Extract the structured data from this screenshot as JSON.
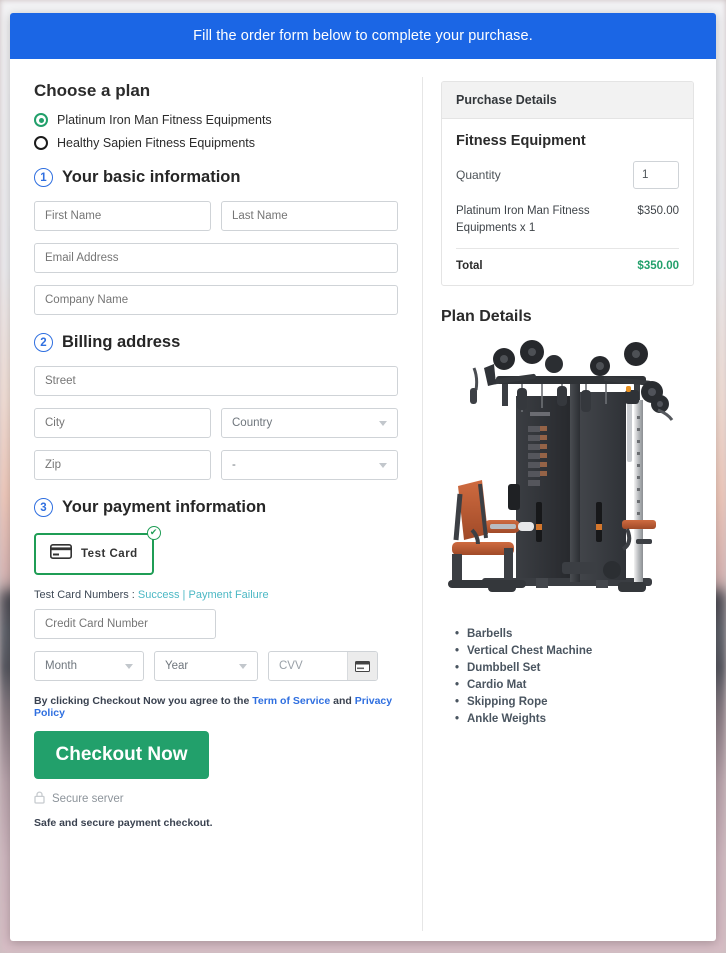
{
  "banner": {
    "text": "Fill the order form below to complete your purchase."
  },
  "plan": {
    "heading": "Choose a plan",
    "options": [
      {
        "label": "Platinum Iron Man Fitness Equipments",
        "selected": true
      },
      {
        "label": "Healthy Sapien Fitness Equipments",
        "selected": false
      }
    ]
  },
  "steps": {
    "basic": {
      "number": "1",
      "title": "Your basic information"
    },
    "billing": {
      "number": "2",
      "title": "Billing address"
    },
    "payment": {
      "number": "3",
      "title": "Your payment information"
    }
  },
  "fields": {
    "first_name": {
      "placeholder": "First Name",
      "value": ""
    },
    "last_name": {
      "placeholder": "Last Name",
      "value": ""
    },
    "email": {
      "placeholder": "Email Address",
      "value": ""
    },
    "company": {
      "placeholder": "Company Name",
      "value": ""
    },
    "street": {
      "placeholder": "Street",
      "value": ""
    },
    "city": {
      "placeholder": "City",
      "value": ""
    },
    "country": {
      "placeholder": "Country",
      "value": "Country"
    },
    "zip": {
      "placeholder": "Zip",
      "value": ""
    },
    "state": {
      "placeholder": "-",
      "value": "-"
    },
    "card_number": {
      "placeholder": "Credit Card Number",
      "value": ""
    },
    "month": {
      "placeholder": "Month",
      "value": "Month"
    },
    "year": {
      "placeholder": "Year",
      "value": "Year"
    },
    "cvv": {
      "placeholder": "CVV",
      "value": ""
    }
  },
  "payment_method": {
    "label": "Test Card",
    "selected": true,
    "check_glyph": "✔"
  },
  "test_cards": {
    "prefix": "Test Card Numbers : ",
    "success": "Success",
    "separator": " | ",
    "failure": "Payment Failure"
  },
  "terms": {
    "prefix": "By clicking Checkout Now you agree to the ",
    "tos": "Term of Service",
    "and": " and ",
    "privacy": "Privacy Policy"
  },
  "checkout": {
    "button": "Checkout Now",
    "secure_server": "Secure server",
    "safe_note": "Safe and secure payment checkout."
  },
  "purchase_details": {
    "header": "Purchase Details",
    "product_title": "Fitness Equipment",
    "quantity_label": "Quantity",
    "quantity_value": "1",
    "line_item": "Platinum Iron Man Fitness Equipments x 1",
    "line_amount": "$350.00",
    "total_label": "Total",
    "total_amount": "$350.00"
  },
  "plan_details": {
    "heading": "Plan Details",
    "features": [
      "Barbells",
      "Vertical Chest Machine",
      "Dumbbell Set",
      "Cardio Mat",
      "Skipping Rope",
      "Ankle Weights"
    ]
  },
  "colors": {
    "banner_blue": "#1b66e5",
    "accent_green": "#22a06b",
    "link_teal": "#4cb8c4",
    "link_blue": "#2f6fe0",
    "step_blue": "#2f6fe0"
  }
}
